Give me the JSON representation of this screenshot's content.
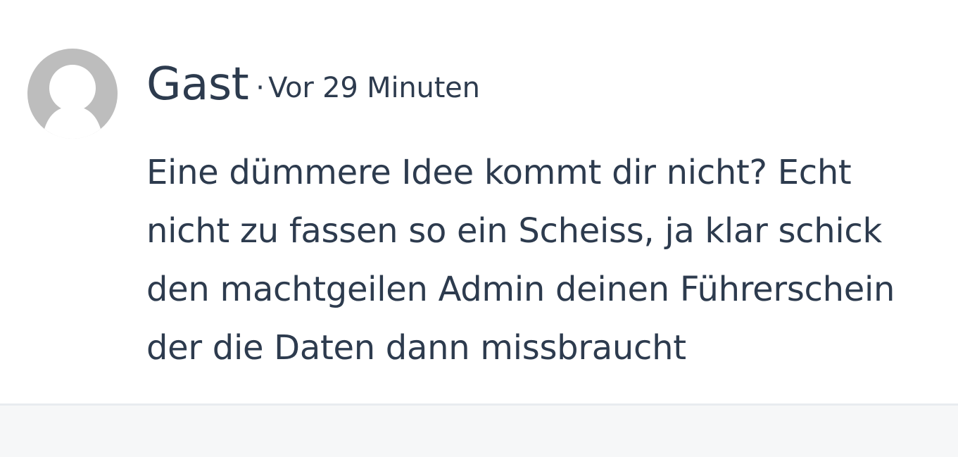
{
  "comment": {
    "author": "Gast",
    "separator": "·",
    "timestamp": "Vor 29 Minuten",
    "avatar_icon": "default-user-icon",
    "avatar_color": "#bdbdbd",
    "text_lines": [
      "Eine dümmere Idee kommt dir nicht? Echt",
      "nicht zu fassen so ein Scheiss, ja klar schick",
      "den machtgeilen Admin deinen Führerschein",
      "der die Daten dann missbraucht"
    ]
  },
  "colors": {
    "text": "#2d3b4e",
    "divider": "#e8ecef",
    "footer_background": "#f6f7f8"
  }
}
